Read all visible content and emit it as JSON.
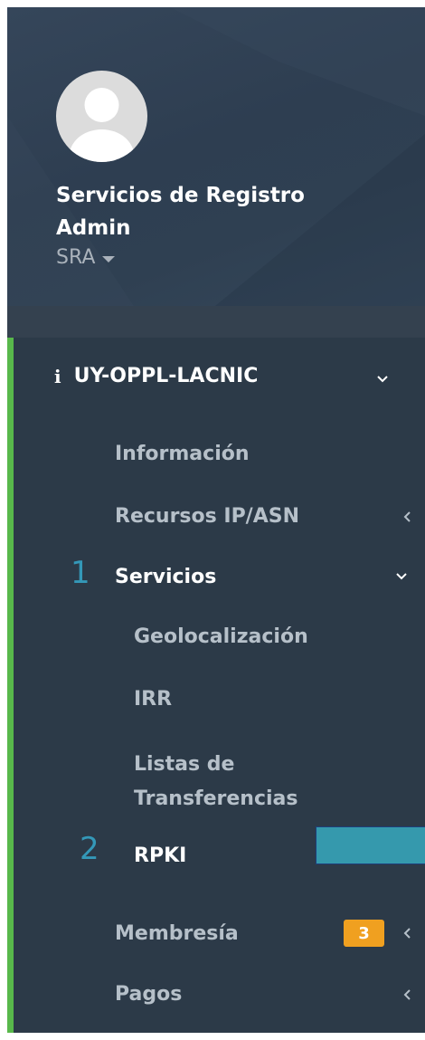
{
  "user": {
    "name": "Servicios de Registro Admin",
    "role": "SRA"
  },
  "nav": {
    "org": {
      "label": "UY-OPPL-LACNIC",
      "icon": "info-icon"
    },
    "items": [
      {
        "label": "Información"
      },
      {
        "label": "Recursos IP/ASN"
      },
      {
        "label": "Servicios",
        "annotation": "1"
      },
      {
        "label": "Membresía",
        "badge": "3"
      },
      {
        "label": "Pagos"
      }
    ],
    "servicios_children": [
      {
        "label": "Geolocalización"
      },
      {
        "label": "IRR"
      },
      {
        "label": "Listas de Transferencias"
      },
      {
        "label": "RPKI",
        "annotation": "2"
      }
    ]
  },
  "colors": {
    "sidebar_bg": "#2c3a48",
    "active_bar": "#58b84b",
    "badge": "#f0a020",
    "annotation": "#3498b8",
    "highlight": "#3599ad"
  }
}
